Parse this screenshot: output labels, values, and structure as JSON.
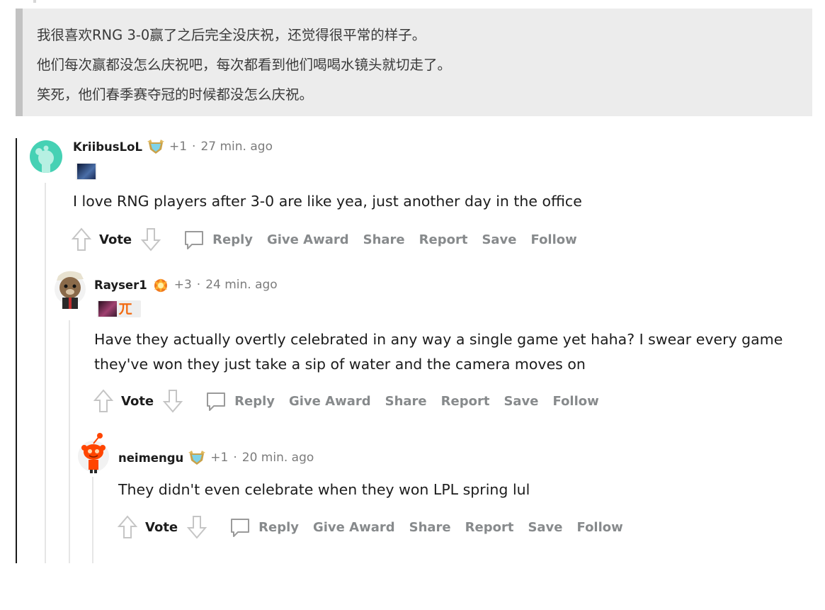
{
  "quote": {
    "lines": [
      "我很喜欢RNG 3-0赢了之后完全没庆祝，还觉得很平常的样子。",
      "他们每次赢都没怎么庆祝吧，每次都看到他们喝喝水镜头就切走了。",
      "笑死，他们春季赛夺冠的时候都没怎么庆祝。"
    ]
  },
  "comments": [
    {
      "author": "KriibusLoL",
      "points": "+1",
      "separator": "·",
      "time": "27 min. ago",
      "body_lines": [
        "I love RNG players after 3-0 are like yea, just another day in the office"
      ],
      "award_icon": "diamond-award-icon"
    },
    {
      "author": "Rayser1",
      "points": "+3",
      "separator": "·",
      "time": "24 min. ago",
      "body_lines": [
        "Have they actually overtly celebrated in any way a single game yet haha? I swear every game",
        "they've won they just take a sip of water and the camera moves on"
      ],
      "award_icon": "fire-award-icon",
      "flair_text": "ㄫ"
    },
    {
      "author": "neimengu",
      "points": "+1",
      "separator": "·",
      "time": "20 min. ago",
      "body_lines": [
        "They didn't even celebrate when they won LPL spring lul"
      ],
      "award_icon": "diamond-award-icon"
    }
  ],
  "actions": {
    "vote": "Vote",
    "reply": "Reply",
    "give_award": "Give Award",
    "share": "Share",
    "report": "Report",
    "save": "Save",
    "follow": "Follow"
  },
  "colors": {
    "quote_bg": "#ececec",
    "quote_border": "#c2c2c2",
    "meta_gray": "#7c7c7c",
    "action_gray": "#878a8c",
    "snoo_teal": "#46d1b4",
    "snoo_red": "#ff4500"
  }
}
